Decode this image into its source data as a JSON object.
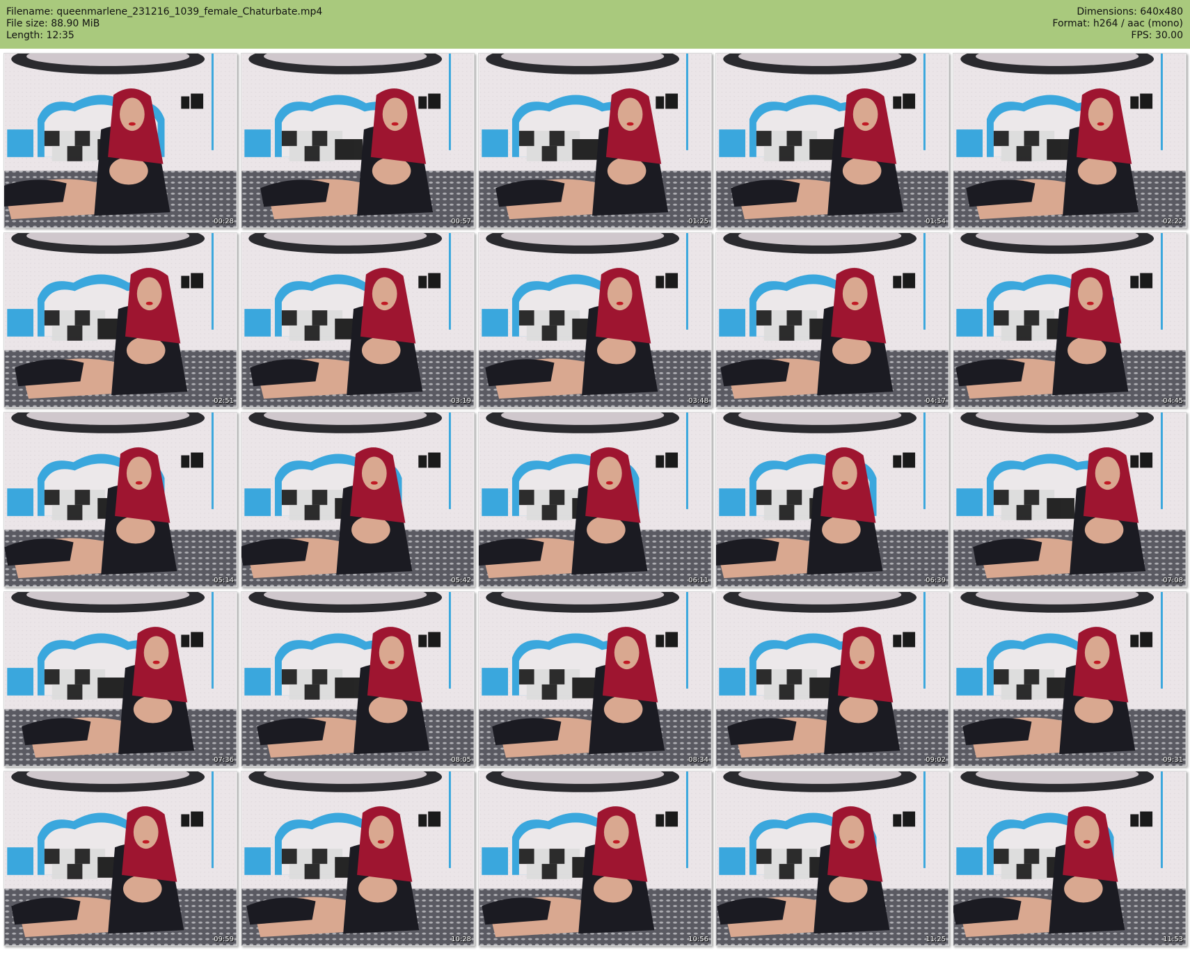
{
  "header": {
    "filename_label": "Filename: queenmarlene_231216_1039_female_Chaturbate.mp4",
    "filesize_label": "File size: 88.90 MiB",
    "length_label": "Length: 12:35",
    "dimensions_label": "Dimensions: 640x480",
    "format_label": "Format: h264 / aac (mono)",
    "fps_label": "FPS: 30.00"
  },
  "colors": {
    "header_bg": "#a9c97d",
    "wall": "#ebe5e8",
    "headboard_frame": "#3aa7dd",
    "headboard_panel": "#ece8ea",
    "hair": "#9e1530",
    "outfit": "#1b1b22",
    "skin": "#d9a890",
    "bedding": "#5a5a62"
  },
  "thumbnails": [
    {
      "time": "00:28"
    },
    {
      "time": "00:57"
    },
    {
      "time": "01:25"
    },
    {
      "time": "01:54"
    },
    {
      "time": "02:22"
    },
    {
      "time": "02:51"
    },
    {
      "time": "03:19"
    },
    {
      "time": "03:48"
    },
    {
      "time": "04:17"
    },
    {
      "time": "04:45"
    },
    {
      "time": "05:14"
    },
    {
      "time": "05:42"
    },
    {
      "time": "06:11"
    },
    {
      "time": "06:39"
    },
    {
      "time": "07:08"
    },
    {
      "time": "07:36"
    },
    {
      "time": "08:05"
    },
    {
      "time": "08:34"
    },
    {
      "time": "09:02"
    },
    {
      "time": "09:31"
    },
    {
      "time": "09:59"
    },
    {
      "time": "10:28"
    },
    {
      "time": "10:56"
    },
    {
      "time": "11:25"
    },
    {
      "time": "11:53"
    }
  ]
}
